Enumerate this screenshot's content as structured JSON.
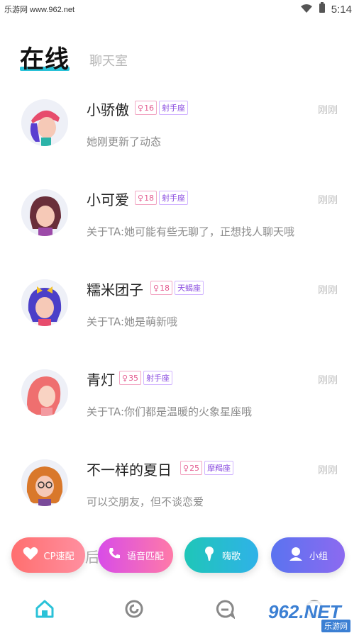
{
  "status_bar": {
    "site": "乐游网 www.962.net",
    "time": "5:14"
  },
  "tabs": {
    "active": "在线",
    "inactive": "聊天室"
  },
  "users": [
    {
      "name": "小骄傲",
      "age": "16",
      "zodiac": "射手座",
      "time": "刚刚",
      "desc": "她刚更新了动态"
    },
    {
      "name": "小可爱",
      "age": "18",
      "zodiac": "射手座",
      "time": "刚刚",
      "desc": "关于TA:她可能有些无聊了，正想找人聊天哦"
    },
    {
      "name": "糯米团子",
      "age": "18",
      "zodiac": "天蝎座",
      "time": "刚刚",
      "desc": "关于TA:她是萌新哦"
    },
    {
      "name": "青灯",
      "age": "35",
      "zodiac": "射手座",
      "time": "刚刚",
      "desc": "关于TA:你们都是温暖的火象星座哦"
    },
    {
      "name": "不一样的夏日",
      "age": "25",
      "zodiac": "摩羯座",
      "time": "刚刚",
      "desc": "可以交朋友，但不谈恋爱"
    }
  ],
  "partial_row_text": "后",
  "actions": {
    "cp": "CP速配",
    "voice": "语音匹配",
    "sing": "嗨歌",
    "group": "小组"
  },
  "watermark": {
    "big": "962.NET",
    "small": "乐游网"
  },
  "colors": {
    "accent": "#2ac2d8",
    "badge_age": "#e45b8f",
    "badge_zodiac": "#8a4ce0"
  },
  "icons": {
    "nav": [
      "home-icon",
      "discover-icon",
      "message-icon",
      "profile-icon"
    ]
  }
}
